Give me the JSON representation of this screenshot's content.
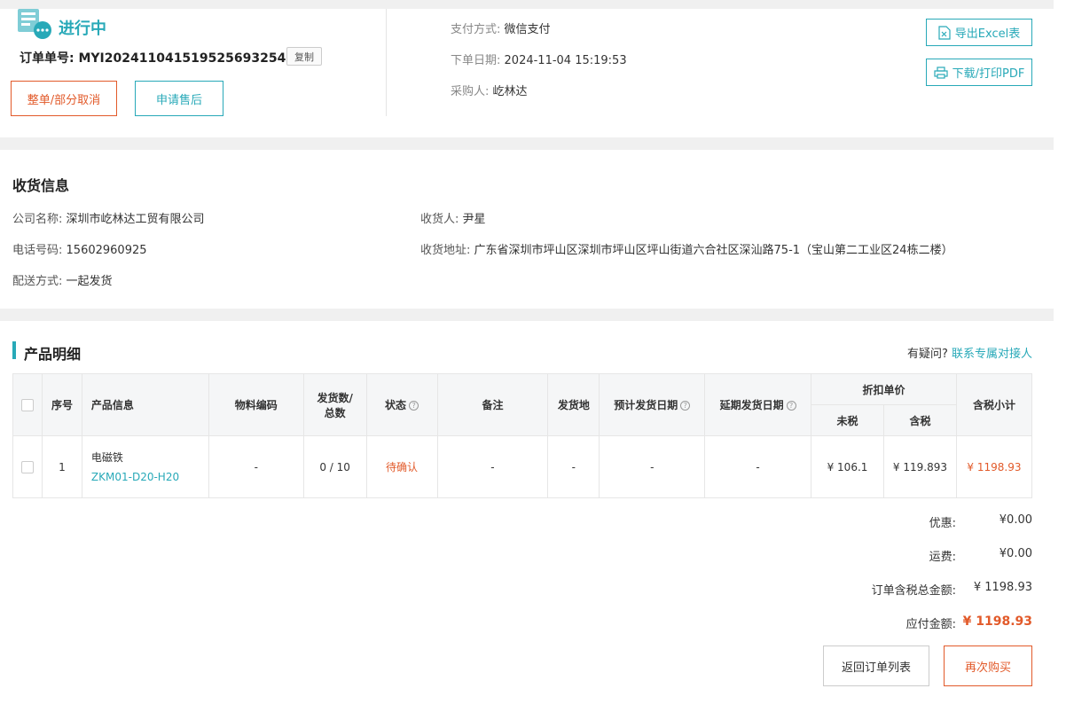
{
  "header": {
    "status": "进行中",
    "order_no_label": "订单单号:",
    "order_no": "MYI20241104151952569325​4S",
    "copy_label": "复制",
    "cancel_label": "整单/部分取消",
    "aftersale_label": "申请售后",
    "payment_label": "支付方式:",
    "payment_value": "微信支付",
    "date_label": "下单日期:",
    "date_value": "2024-11-04 15:19:53",
    "buyer_label": "采购人:",
    "buyer_value": "屹林达",
    "export_label": "导出Excel表",
    "pdf_label": "下载/打印PDF"
  },
  "shipping": {
    "title": "收货信息",
    "company_label": "公司名称:",
    "company_value": "深圳市屹林达工贸有限公司",
    "phone_label": "电话号码:",
    "phone_value": "15602960925",
    "delivery_label": "配送方式:",
    "delivery_value": "一起发货",
    "receiver_label": "收货人:",
    "receiver_value": "尹星",
    "address_label": "收货地址:",
    "address_value": "广东省深圳市坪山区深圳市坪山区坪山街道六合社区深汕路75-1（宝山第二工业区24栋二楼）"
  },
  "products": {
    "title": "产品明细",
    "question": "有疑问?",
    "contact_link": "联系专属对接人",
    "columns": {
      "seq": "序号",
      "info": "产品信息",
      "material": "物料编码",
      "shipped_a": "发货数/",
      "shipped_b": "总数",
      "status": "状态",
      "remark": "备注",
      "origin": "发货地",
      "eta": "预计发货日期",
      "delay": "延期发货日期",
      "price": "折扣单价",
      "untaxed": "未税",
      "taxed": "含税",
      "subtotal": "含税小计"
    },
    "rows": [
      {
        "seq": "1",
        "name": "电磁铁",
        "model": "ZKM01-D20-H20",
        "material": "-",
        "shipped": "0 / 10",
        "status": "待确认",
        "remark": "-",
        "origin": "-",
        "eta": "-",
        "delay": "-",
        "untaxed": "¥ 106.1",
        "taxed": "¥ 119.893",
        "subtotal": "¥ 1198.93"
      }
    ]
  },
  "summary": {
    "discount_label": "优惠:",
    "discount_value": "¥0.00",
    "freight_label": "运费:",
    "freight_value": "¥0.00",
    "total_label": "订单含税总金额:",
    "total_value": "¥ 1198.93",
    "payable_label": "应付金额:",
    "payable_value": "¥ 1198.93",
    "back_label": "返回订单列表",
    "rebuy_label": "再次购买"
  },
  "colors": {
    "accent": "#28a9b8",
    "warn": "#e25a2a"
  },
  "icons": [
    "order-status-icon",
    "excel-icon",
    "printer-icon",
    "help-icon",
    "checkbox-icon"
  ]
}
